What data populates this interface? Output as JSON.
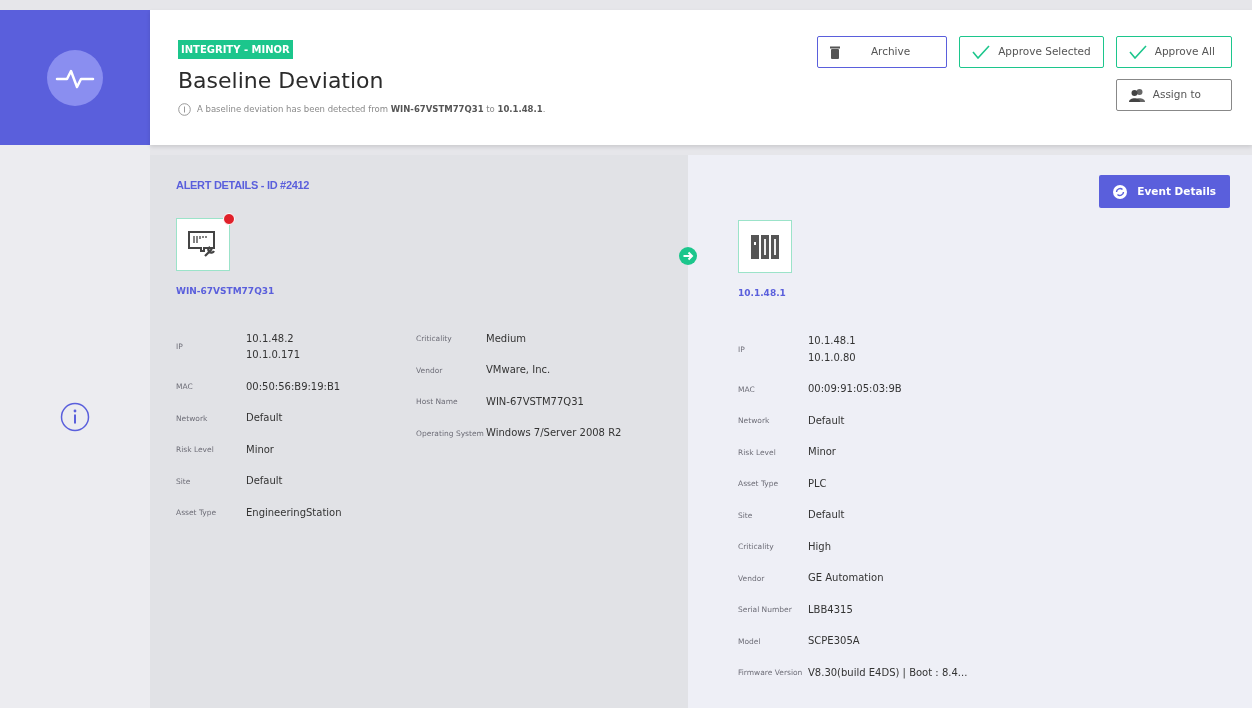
{
  "header": {
    "tag": "INTEGRITY - MINOR",
    "title": "Baseline Deviation",
    "description": "A baseline deviation has been detected from **WIN-67VSTM77Q31** to **10.1.48.1**.",
    "buttons": [
      {
        "label": "Archive",
        "kind": "archive"
      },
      {
        "label": "Approve Selected",
        "kind": "approve"
      },
      {
        "label": "Approve All",
        "kind": "approve"
      },
      {
        "label": "Assign to",
        "kind": "assign"
      }
    ]
  },
  "alert_details": {
    "title": "ALERT DETAILS - ID #2412",
    "source": {
      "name": "WIN-67VSTM77Q31",
      "kind": "workstation",
      "alert": true,
      "columns": [
        [
          {
            "label": "IP",
            "values": [
              "10.1.48.2",
              "10.1.0.171"
            ]
          },
          {
            "label": "MAC",
            "values": [
              "00:50:56:B9:19:B1"
            ]
          },
          {
            "label": "Network",
            "values": [
              "Default"
            ]
          },
          {
            "label": "Risk Level",
            "values": [
              "Minor"
            ]
          },
          {
            "label": "Site",
            "values": [
              "Default"
            ]
          },
          {
            "label": "Asset Type",
            "values": [
              "EngineeringStation"
            ]
          }
        ],
        [
          {
            "label": "Criticality",
            "values": [
              "Medium"
            ]
          },
          {
            "label": "Vendor",
            "values": [
              "VMware, Inc."
            ]
          },
          {
            "label": "Host Name",
            "values": [
              "WIN-67VSTM77Q31"
            ]
          },
          {
            "label": "Operating System",
            "values": [
              "Windows 7/Server 2008 R2"
            ]
          }
        ]
      ]
    },
    "event_button": "Event Details",
    "destination": {
      "name": "10.1.48.1",
      "kind": "plc",
      "alert": false,
      "columns": [
        [
          {
            "label": "IP",
            "values": [
              "10.1.48.1",
              "10.1.0.80"
            ]
          },
          {
            "label": "MAC",
            "values": [
              "00:09:91:05:03:9B"
            ]
          },
          {
            "label": "Network",
            "values": [
              "Default"
            ]
          },
          {
            "label": "Risk Level",
            "values": [
              "Minor"
            ]
          },
          {
            "label": "Asset Type",
            "values": [
              "PLC"
            ]
          },
          {
            "label": "Site",
            "values": [
              "Default"
            ]
          },
          {
            "label": "Criticality",
            "values": [
              "High"
            ]
          },
          {
            "label": "Vendor",
            "values": [
              "GE Automation"
            ]
          },
          {
            "label": "Serial Number",
            "values": [
              "LBB4315"
            ]
          },
          {
            "label": "Model",
            "values": [
              "SCPE305A"
            ]
          },
          {
            "label": "Firmware Version",
            "values": [
              "V8.30(build E4DS) | Boot : 8.4..."
            ]
          }
        ]
      ]
    }
  }
}
